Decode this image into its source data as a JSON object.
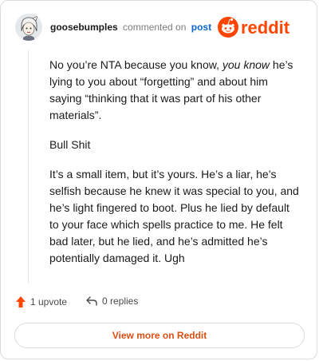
{
  "header": {
    "username": "goosebumples",
    "action_text": "commented on",
    "post_link": "post",
    "brand": "reddit",
    "brand_color": "#ff4500"
  },
  "comment": {
    "paragraph1_before": "No you’re NTA because you know, ",
    "paragraph1_italic": "you know",
    "paragraph1_after": " he’s lying to you about “forgetting” and about him saying “thinking that it was part of his other materials”.",
    "paragraph2": "Bull Shit",
    "paragraph3": "It’s a small item, but it’s yours. He’s a liar, he’s selfish because he knew it was special to you, and he’s light fingered to boot. Plus he lied by default to your face which spells practice to me. He felt bad later, but he lied, and he’s admitted he’s potentially damaged it. Ugh"
  },
  "footer": {
    "upvote_label": "1 upvote",
    "upvote_icon": "upvote-arrow-icon",
    "upvote_color": "#ff4500",
    "replies_label": "0 replies",
    "replies_icon": "reply-arrow-icon"
  },
  "cta": {
    "label": "View more on Reddit",
    "color": "#d94f12"
  }
}
